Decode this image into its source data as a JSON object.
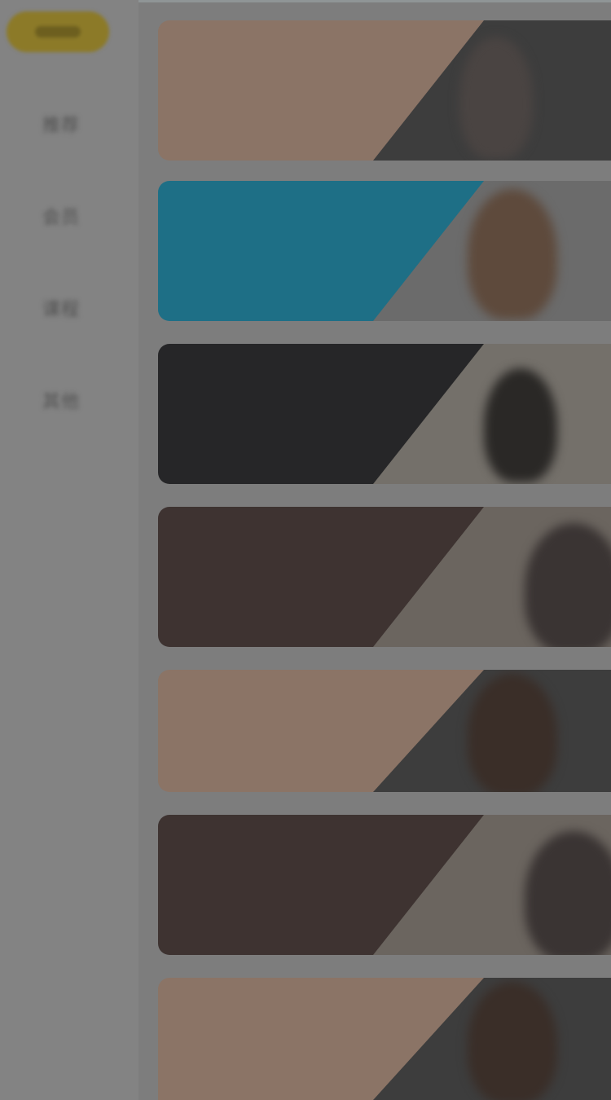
{
  "sidebar": {
    "items": [
      {
        "label": "推荐"
      },
      {
        "label": "会员"
      },
      {
        "label": "课程"
      },
      {
        "label": "其他"
      }
    ]
  },
  "cards": [
    {
      "line1": "",
      "line2": "",
      "line3": "",
      "line4": "",
      "panel_color": "#8b7466",
      "photo_color": "#3d3d3d"
    },
    {
      "line1": "",
      "line2": "",
      "line3": "",
      "line4": "",
      "panel_color": "#1e6f86",
      "photo_color": "#6b6b6b"
    },
    {
      "line1": "",
      "line2": "",
      "line3": "",
      "line4": "",
      "panel_color": "#262628",
      "photo_color": "#74706a"
    },
    {
      "line1": "",
      "line2": "",
      "line3": "",
      "line4": "",
      "panel_color": "#3e3331",
      "photo_color": "#6b655f"
    },
    {
      "line1": "",
      "line2": "",
      "line3": "",
      "line4": "",
      "panel_color": "#8b7466",
      "photo_color": "#3d3d3d"
    },
    {
      "line1": "",
      "line2": "",
      "line3": "",
      "line4": "",
      "panel_color": "#3e3331",
      "photo_color": "#6b655f"
    },
    {
      "line1": "",
      "line2": "",
      "line3": "",
      "line4": "",
      "panel_color": "#8b7466",
      "photo_color": "#3d3d3d"
    }
  ]
}
